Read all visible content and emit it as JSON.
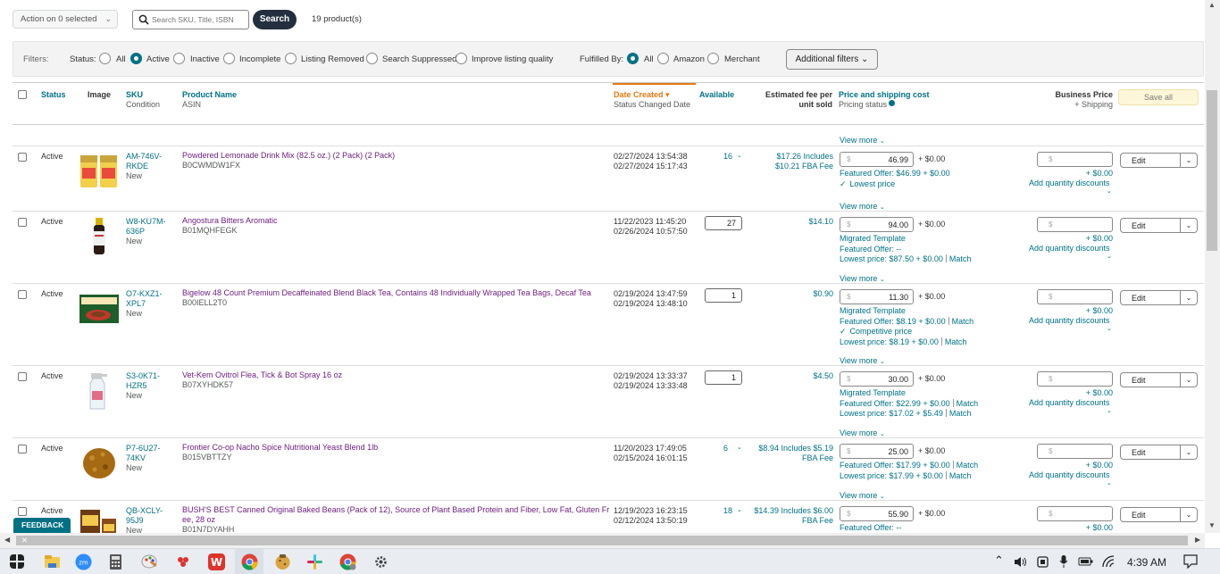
{
  "toolbar": {
    "action_label": "Action on 0 selected",
    "search_placeholder": "Search SKU, Title, ISBN",
    "search_label": "Search",
    "product_count": "19 product(s)"
  },
  "filters": {
    "label": "Filters:",
    "status_label": "Status:",
    "status_options": [
      "All",
      "Active",
      "Inactive",
      "Incomplete",
      "Listing Removed",
      "Search Suppressed",
      "Improve listing quality"
    ],
    "status_selected": "Active",
    "fulfilled_label": "Fulfilled By:",
    "fulfilled_options": [
      "All",
      "Amazon",
      "Merchant"
    ],
    "fulfilled_selected": "All",
    "additional_label": "Additional filters"
  },
  "columns": {
    "status": "Status",
    "image": "Image",
    "sku": "SKU",
    "condition": "Condition",
    "product_name": "Product Name",
    "asin": "ASIN",
    "date_created": "Date Created",
    "status_changed": "Status Changed Date",
    "available": "Available",
    "fee_line1": "Estimated fee per",
    "fee_line2": "unit sold",
    "price_shipping": "Price and shipping cost",
    "pricing_status": "Pricing status",
    "business_price": "Business Price",
    "plus_shipping": "+ Shipping",
    "save_all": "Save all"
  },
  "common": {
    "view_more": "View more",
    "currency": "$",
    "plus_zero": "+ $0.00",
    "add_qty_discounts": "Add quantity discounts",
    "edit": "Edit",
    "match": "Match"
  },
  "rows": [
    {
      "status": "Active",
      "sku1": "AM-746V-",
      "sku2": "RKDE",
      "condition": "New",
      "name": "Powdered Lemonade Drink Mix (82.5 oz.) (2 Pack) (2 Pack)",
      "name2": "",
      "asin": "B0CWMDW1FX",
      "created": "02/27/2024 13:54:38",
      "changed": "02/27/2024 15:17:43",
      "available": "16",
      "fee1": "$17.26 Includes",
      "fee2": "$10.21 FBA Fee",
      "price": "46.99",
      "info": [
        {
          "text": "Featured Offer: $46.99 + $0.00"
        },
        {
          "check": true,
          "text": "Lowest price"
        }
      ]
    },
    {
      "status": "Active",
      "sku1": "W8-KU7M-",
      "sku2": "636P",
      "condition": "New",
      "name": "Angostura Bitters Aromatic",
      "name2": "",
      "asin": "B01MQHFEGK",
      "created": "11/22/2023 11:45:20",
      "changed": "02/26/2024 10:57:50",
      "available": "27",
      "fee1": "$14.10",
      "fee2": "",
      "price": "94.00",
      "info": [
        {
          "text": "Migrated Template"
        },
        {
          "text": "Featured Offer: --"
        },
        {
          "text": "Lowest price: $87.50 + $0.00",
          "match": true
        }
      ]
    },
    {
      "status": "Active",
      "sku1": "O7-KXZ1-",
      "sku2": "XPL7",
      "condition": "New",
      "name": "Bigelow 48 Count Premium Decaffeinated Blend Black Tea, Contains 48 Individually Wrapped Tea Bags, Decaf Tea",
      "name2": "",
      "asin": "B00IELL2T0",
      "created": "02/19/2024 13:47:59",
      "changed": "02/19/2024 13:48:10",
      "available": "1",
      "fee1": "$0.90",
      "fee2": "",
      "price": "11.30",
      "info": [
        {
          "text": "Migrated Template"
        },
        {
          "text": "Featured Offer: $8.19 + $0.00",
          "match": true
        },
        {
          "check": true,
          "text": "Competitive price"
        },
        {
          "text": "Lowest price: $8.19 + $0.00",
          "match": true
        }
      ]
    },
    {
      "status": "Active",
      "sku1": "S3-0K71-",
      "sku2": "HZR5",
      "condition": "New",
      "name": "Vet-Kem Ovitrol Flea, Tick & Bot Spray 16 oz",
      "name2": "",
      "asin": "B07XYHDK57",
      "created": "02/19/2024 13:33:37",
      "changed": "02/19/2024 13:33:48",
      "available": "1",
      "fee1": "$4.50",
      "fee2": "",
      "price": "30.00",
      "info": [
        {
          "text": "Migrated Template"
        },
        {
          "text": "Featured Offer: $22.99 + $0.00",
          "match": true
        },
        {
          "text": "Lowest price: $17.02 + $5.49",
          "match": true
        }
      ]
    },
    {
      "status": "Active",
      "sku1": "P7-6U27-",
      "sku2": "74KV",
      "condition": "New",
      "name": "Frontier Co-op Nacho Spice Nutritional Yeast Blend 1lb",
      "name2": "",
      "asin": "B015VBTTZY",
      "created": "11/20/2023 17:49:05",
      "changed": "02/15/2024 16:01:15",
      "available": "6",
      "fee1": "$8.94 Includes $5.19",
      "fee2": "FBA Fee",
      "price": "25.00",
      "info": [
        {
          "text": "Featured Offer: $17.99 + $0.00",
          "match": true
        },
        {
          "text": "Lowest price: $17.99 + $0.00",
          "match": true
        }
      ]
    },
    {
      "status": "Active",
      "sku1": "QB-XCLY-",
      "sku2": "95J9",
      "condition": "New",
      "name": "BUSH'S BEST Canned Original Baked Beans (Pack of 12), Source of Plant Based Protein and Fiber, Low Fat, Gluten Fr",
      "name2": "ee, 28 oz",
      "asin": "B01N7DYAHH",
      "created": "12/19/2023 16:23:15",
      "changed": "02/12/2024 13:50:19",
      "available": "18",
      "fee1": "$14.39 Includes $6.00",
      "fee2": "FBA Fee",
      "price": "55.90",
      "info": [
        {
          "text": "Featured Offer: --"
        }
      ]
    }
  ],
  "feedback": {
    "label": "FEEDBACK"
  },
  "taskbar": {
    "time": "4:39 AM",
    "apps": [
      "windows-start",
      "file-explorer",
      "zoom",
      "calculator",
      "paint",
      "app-red",
      "wps-office",
      "chrome",
      "app-cookie",
      "slack",
      "chrome-profile",
      "settings"
    ]
  }
}
